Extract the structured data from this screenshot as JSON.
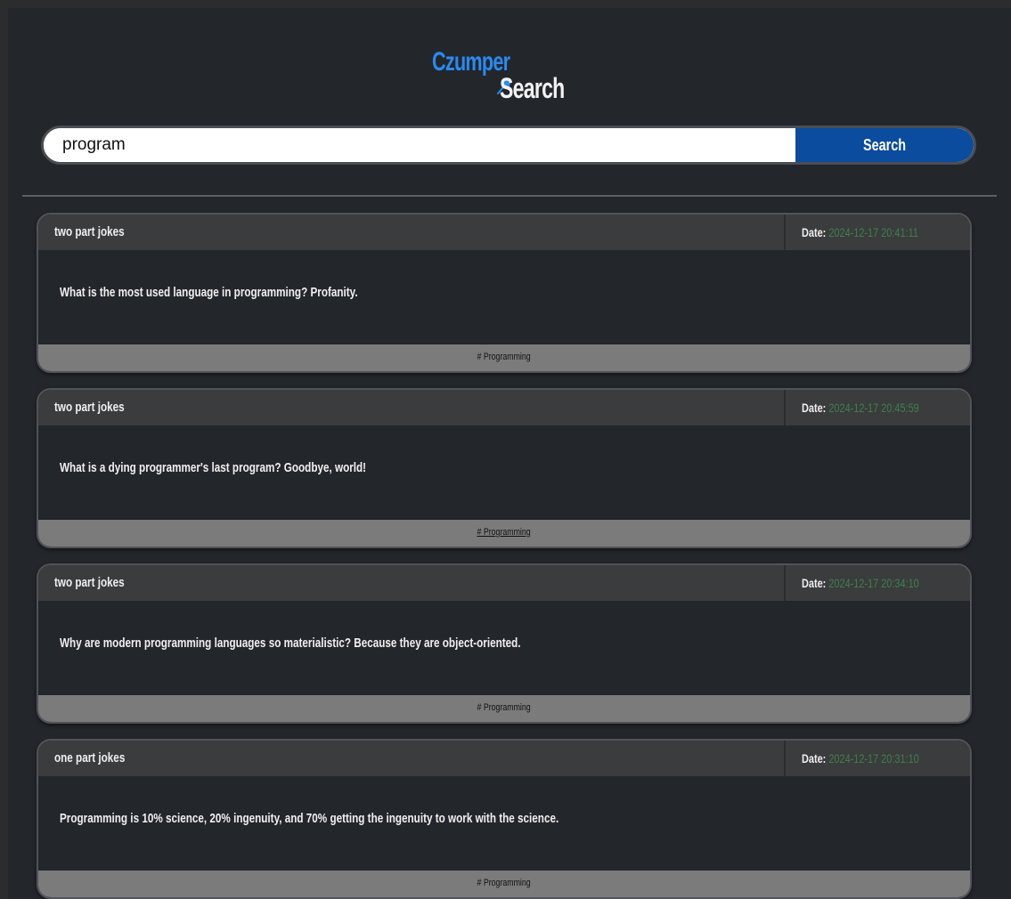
{
  "logo": {
    "line1": "Czumper",
    "line2": "Search",
    "colors": {
      "line1": "#2a8af0",
      "line2": "#f2f2f2"
    },
    "icon": "magnifier-icon"
  },
  "search": {
    "value": "program",
    "button_label": "Search",
    "button_color": "#0b4c9e"
  },
  "results": [
    {
      "category": "two part jokes",
      "date_label": "Date:",
      "date": "2024-12-17 20:41:11",
      "text": "What is the most used language in programming? Profanity.",
      "tag": "# Programming"
    },
    {
      "category": "two part jokes",
      "date_label": "Date:",
      "date": "2024-12-17 20:45:59",
      "text": "What is a dying programmer's last program? Goodbye, world!",
      "tag": "# Programming"
    },
    {
      "category": "two part jokes",
      "date_label": "Date:",
      "date": "2024-12-17 20:34:10",
      "text": "Why are modern programming languages so materialistic? Because they are object-oriented.",
      "tag": "# Programming"
    },
    {
      "category": "one part jokes",
      "date_label": "Date:",
      "date": "2024-12-17 20:31:10",
      "text": "Programming is 10% science, 20% ingenuity, and 70% getting the ingenuity to work with the science.",
      "tag": "# Programming"
    }
  ],
  "colors": {
    "page_bg": "#23262b",
    "card_header": "#3b3c3e",
    "card_footer": "#7b7b7b",
    "date_value": "#3f7f4a"
  }
}
